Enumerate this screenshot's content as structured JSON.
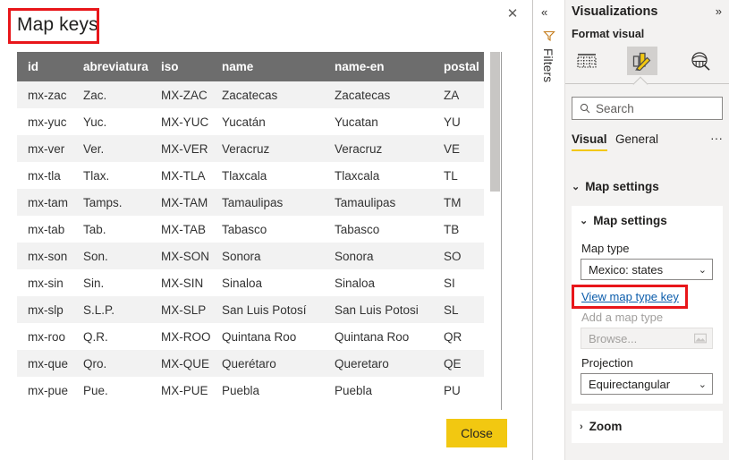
{
  "dialog": {
    "title": "Map keys",
    "close_x": "✕",
    "close_button": "Close",
    "columns": [
      "id",
      "abreviatura",
      "iso",
      "name",
      "name-en",
      "postal"
    ],
    "rows": [
      [
        "mx-zac",
        "Zac.",
        "MX-ZAC",
        "Zacatecas",
        "Zacatecas",
        "ZA"
      ],
      [
        "mx-yuc",
        "Yuc.",
        "MX-YUC",
        "Yucatán",
        "Yucatan",
        "YU"
      ],
      [
        "mx-ver",
        "Ver.",
        "MX-VER",
        "Veracruz",
        "Veracruz",
        "VE"
      ],
      [
        "mx-tla",
        "Tlax.",
        "MX-TLA",
        "Tlaxcala",
        "Tlaxcala",
        "TL"
      ],
      [
        "mx-tam",
        "Tamps.",
        "MX-TAM",
        "Tamaulipas",
        "Tamaulipas",
        "TM"
      ],
      [
        "mx-tab",
        "Tab.",
        "MX-TAB",
        "Tabasco",
        "Tabasco",
        "TB"
      ],
      [
        "mx-son",
        "Son.",
        "MX-SON",
        "Sonora",
        "Sonora",
        "SO"
      ],
      [
        "mx-sin",
        "Sin.",
        "MX-SIN",
        "Sinaloa",
        "Sinaloa",
        "SI"
      ],
      [
        "mx-slp",
        "S.L.P.",
        "MX-SLP",
        "San Luis Potosí",
        "San Luis Potosi",
        "SL"
      ],
      [
        "mx-roo",
        "Q.R.",
        "MX-ROO",
        "Quintana Roo",
        "Quintana Roo",
        "QR"
      ],
      [
        "mx-que",
        "Qro.",
        "MX-QUE",
        "Querétaro",
        "Queretaro",
        "QE"
      ],
      [
        "mx-pue",
        "Pue.",
        "MX-PUE",
        "Puebla",
        "Puebla",
        "PU"
      ]
    ]
  },
  "filters_rail": {
    "collapse_glyph": "«",
    "label": "Filters"
  },
  "viz_pane": {
    "header": "Visualizations",
    "expand_glyph": "»",
    "subheader": "Format visual",
    "icons": [
      {
        "name": "build-visual-icon",
        "selected": false
      },
      {
        "name": "format-visual-icon",
        "selected": true
      },
      {
        "name": "analytics-icon",
        "selected": false
      }
    ],
    "search": {
      "placeholder": "Search",
      "value": "",
      "icon": "search-icon"
    },
    "tabs": [
      {
        "label": "Visual",
        "active": true
      },
      {
        "label": "General",
        "active": false
      }
    ],
    "tab_more": "···",
    "section_header": {
      "label": "Map settings",
      "chevron": "⌄"
    },
    "map_settings_card": {
      "title": "Map settings",
      "chevron": "⌄",
      "map_type_label": "Map type",
      "map_type_value": "Mexico: states",
      "view_key_link": "View map type key",
      "add_map_type_label": "Add a map type",
      "browse_placeholder": "Browse...",
      "browse_icon": "file-picker-icon",
      "projection_label": "Projection",
      "projection_value": "Equirectangular",
      "dropdown_chevron": "⌄"
    },
    "zoom_card": {
      "title": "Zoom",
      "chevron": "›"
    }
  },
  "annotations": {
    "highlight_color": "#e8161a",
    "boxes": [
      "map-keys-title",
      "view-map-type-key-link"
    ]
  },
  "colors": {
    "accent_yellow": "#f2c811",
    "table_header_bg": "#6d6d6d",
    "pane_bg": "#f3f2f1",
    "link_blue": "#0b5cab"
  }
}
